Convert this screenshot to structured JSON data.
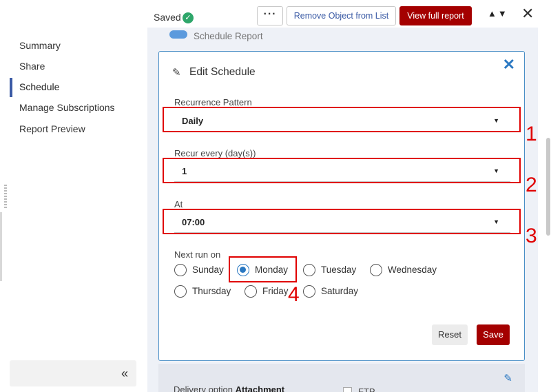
{
  "header": {
    "saved_label": "Saved",
    "more_label": "···",
    "remove_label": "Remove Object from List",
    "full_report_label": "View full report",
    "arrows_label": "▲▼",
    "close_label": "✕"
  },
  "nav": {
    "items": [
      {
        "label": "Summary"
      },
      {
        "label": "Share"
      },
      {
        "label": "Schedule"
      },
      {
        "label": "Manage Subscriptions"
      },
      {
        "label": "Report Preview"
      }
    ],
    "collapse_label": "«"
  },
  "schedule_report_label": "Schedule Report",
  "edit": {
    "title": "Edit Schedule",
    "close_label": "✕",
    "recurrence": {
      "label": "Recurrence Pattern",
      "value": "Daily"
    },
    "recur_every": {
      "label": "Recur every (day(s))",
      "value": "1"
    },
    "at": {
      "label": "At",
      "value": "07:00"
    },
    "next_run": {
      "label": "Next run on",
      "days": [
        "Sunday",
        "Monday",
        "Tuesday",
        "Wednesday",
        "Thursday",
        "Friday",
        "Saturday"
      ],
      "selected": "Monday"
    },
    "reset_label": "Reset",
    "save_label": "Save"
  },
  "delivery": {
    "label": "Delivery option",
    "value": "Attachment",
    "ftp_label": "FTP"
  },
  "annotations": [
    "1",
    "2",
    "3",
    "4"
  ]
}
